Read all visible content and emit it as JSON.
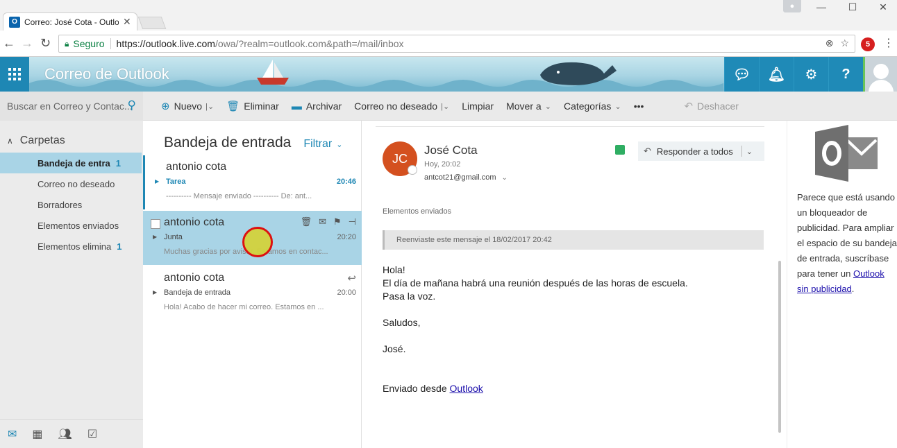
{
  "browser": {
    "tab_title": "Correo: José Cota - Outlook",
    "secure_label": "Seguro",
    "url_main": "https://outlook.live.com",
    "url_rest": "/owa/?realm=outlook.com&path=/mail/inbox",
    "extension_badge": "5"
  },
  "header": {
    "app_title": "Correo de Outlook",
    "buttons": [
      "chat-icon",
      "bell-icon",
      "gear-icon",
      "help-icon"
    ]
  },
  "search": {
    "placeholder": "Buscar en Correo y Contac..."
  },
  "commands": {
    "new": "Nuevo",
    "delete": "Eliminar",
    "archive": "Archivar",
    "junk": "Correo no deseado",
    "sweep": "Limpiar",
    "move": "Mover a",
    "categories": "Categorías",
    "more": "•••",
    "undo": "Deshacer"
  },
  "folders": {
    "header": "Carpetas",
    "items": [
      {
        "label": "Bandeja de entra",
        "count": "1"
      },
      {
        "label": "Correo no deseado",
        "count": ""
      },
      {
        "label": "Borradores",
        "count": ""
      },
      {
        "label": "Elementos enviados",
        "count": ""
      },
      {
        "label": "Elementos elimina",
        "count": "1"
      }
    ]
  },
  "list": {
    "title": "Bandeja de entrada",
    "filter": "Filtrar",
    "messages": [
      {
        "from": "antonio cota",
        "subject": "Tarea",
        "time": "20:46",
        "preview": "---------- Mensaje enviado ---------- De: ant..."
      },
      {
        "from": "antonio cota",
        "subject": "Junta",
        "time": "20:20",
        "preview": "Muchas gracias por avisar. Estamos en contac..."
      },
      {
        "from": "antonio cota",
        "subject": "Bandeja de entrada",
        "time": "20:00",
        "preview": "Hola! Acabo de hacer mi correo. Estamos en ..."
      }
    ]
  },
  "reading": {
    "avatar_initials": "JC",
    "sender_name": "José Cota",
    "sent_time": "Hoy, 20:02",
    "to": "antcot21@gmail.com",
    "reply_all": "Responder a todos",
    "folder": "Elementos enviados",
    "forward_note": "Reenviaste este mensaje el 18/02/2017 20:42",
    "body": {
      "l1": "Hola!",
      "l2": "El día de mañana habrá una reunión después de las horas de escuela.",
      "l3": "Pasa la voz.",
      "l4": "Saludos,",
      "l5": "José.",
      "sent_from": "Enviado desde ",
      "sent_from_link": "Outlook"
    }
  },
  "ad": {
    "text": "Parece que está usando un bloqueador de publicidad. Para ampliar el espacio de su bandeja de entrada, suscríbase para tener un ",
    "link": "Outlook sin publicidad",
    "end": "."
  },
  "colors": {
    "accent": "#1e87b4",
    "selected": "#a9d4e6",
    "avatar": "#d4501f"
  }
}
